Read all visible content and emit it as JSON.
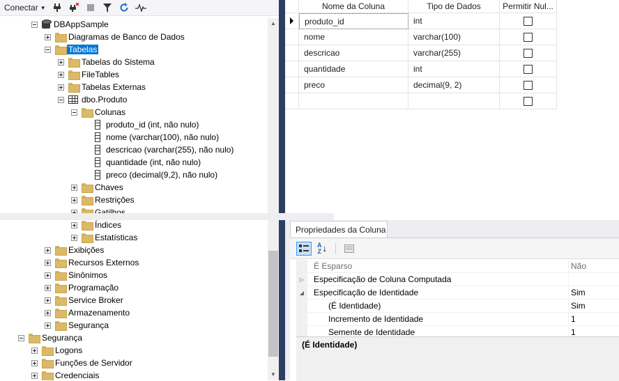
{
  "toolbar": {
    "connect_label": "Conectar",
    "icons": [
      "connect-icon",
      "disconnect-icon",
      "stop-icon",
      "filter-icon",
      "refresh-icon",
      "activity-monitor-icon"
    ]
  },
  "object_explorer": {
    "items": [
      {
        "label": "DBAppSample",
        "icon": "database-icon",
        "expanded": true
      },
      {
        "label": "Diagramas de Banco de Dados",
        "icon": "folder-icon",
        "expanded": false
      },
      {
        "label": "Tabelas",
        "icon": "folder-icon",
        "expanded": true,
        "selected": true
      },
      {
        "label": "Tabelas do Sistema",
        "icon": "folder-icon",
        "expanded": false
      },
      {
        "label": "FileTables",
        "icon": "folder-icon",
        "expanded": false
      },
      {
        "label": "Tabelas Externas",
        "icon": "folder-icon",
        "expanded": false
      },
      {
        "label": "dbo.Produto",
        "icon": "table-icon",
        "expanded": true
      },
      {
        "label": "Colunas",
        "icon": "folder-icon",
        "expanded": true
      },
      {
        "label": "produto_id (int, não nulo)",
        "icon": "column-icon"
      },
      {
        "label": "nome (varchar(100), não nulo)",
        "icon": "column-icon"
      },
      {
        "label": "descricao (varchar(255), não nulo)",
        "icon": "column-icon"
      },
      {
        "label": "quantidade (int, não nulo)",
        "icon": "column-icon"
      },
      {
        "label": "preco (decimal(9,2), não nulo)",
        "icon": "column-icon"
      },
      {
        "label": "Chaves",
        "icon": "folder-icon",
        "expanded": false
      },
      {
        "label": "Restrições",
        "icon": "folder-icon",
        "expanded": false
      },
      {
        "label": "Gatilhos",
        "icon": "folder-icon",
        "expanded": false
      },
      {
        "label": "Índices",
        "icon": "folder-icon",
        "expanded": false
      },
      {
        "label": "Estatísticas",
        "icon": "folder-icon",
        "expanded": false
      },
      {
        "label": "Exibições",
        "icon": "folder-icon",
        "expanded": false
      },
      {
        "label": "Recursos Externos",
        "icon": "folder-icon",
        "expanded": false
      },
      {
        "label": "Sinônimos",
        "icon": "folder-icon",
        "expanded": false
      },
      {
        "label": "Programação",
        "icon": "folder-icon",
        "expanded": false
      },
      {
        "label": "Service Broker",
        "icon": "folder-icon",
        "expanded": false
      },
      {
        "label": "Armazenamento",
        "icon": "folder-icon",
        "expanded": false
      },
      {
        "label": "Segurança",
        "icon": "folder-icon",
        "expanded": false
      },
      {
        "label": "Segurança",
        "icon": "folder-icon",
        "expanded": true
      },
      {
        "label": "Logons",
        "icon": "folder-icon",
        "expanded": false
      },
      {
        "label": "Funções de Servidor",
        "icon": "folder-icon",
        "expanded": false
      },
      {
        "label": "Credenciais",
        "icon": "folder-icon",
        "expanded": false
      }
    ]
  },
  "designer": {
    "headers": {
      "name": "Nome da Coluna",
      "type": "Tipo de Dados",
      "nulls": "Permitir Nul..."
    },
    "rows": [
      {
        "name": "produto_id",
        "type": "int",
        "allow_nulls": false,
        "current": true
      },
      {
        "name": "nome",
        "type": "varchar(100)",
        "allow_nulls": false
      },
      {
        "name": "descricao",
        "type": "varchar(255)",
        "allow_nulls": false
      },
      {
        "name": "quantidade",
        "type": "int",
        "allow_nulls": false
      },
      {
        "name": "preco",
        "type": "decimal(9, 2)",
        "allow_nulls": false
      },
      {
        "name": "",
        "type": "",
        "allow_nulls": false
      }
    ]
  },
  "properties": {
    "tab_label": "Propriedades da Coluna",
    "rows": [
      {
        "name": "É Esparso",
        "value": "Não",
        "dim": true
      },
      {
        "name": "Especificação de Coluna Computada",
        "value": "",
        "group": "collapsed"
      },
      {
        "name": "Especificação de Identidade",
        "value": "Sim",
        "group": "expanded"
      },
      {
        "name": "(É Identidade)",
        "value": "Sim",
        "sub": true
      },
      {
        "name": "Incremento de Identidade",
        "value": "1",
        "sub": true
      },
      {
        "name": "Semente de Identidade",
        "value": "1",
        "sub": true
      }
    ],
    "description_title": "(É Identidade)"
  }
}
